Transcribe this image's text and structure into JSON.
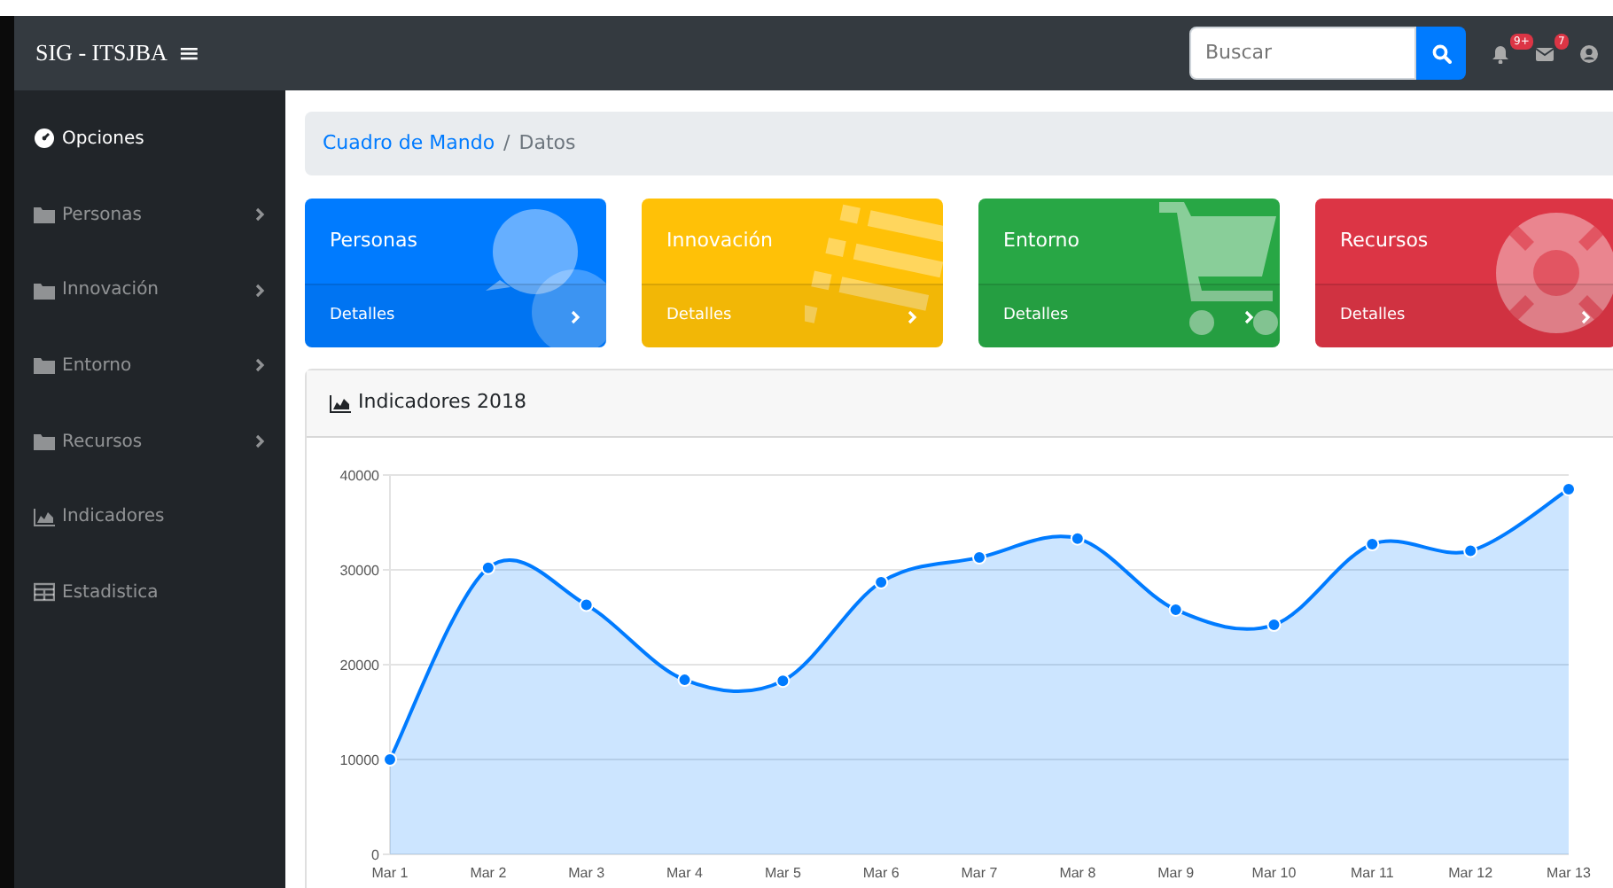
{
  "navbar": {
    "brand": "SIG - ITSJBA",
    "menu_toggle": "≡",
    "search": {
      "placeholder": "Buscar"
    },
    "alerts": {
      "badge": "9+"
    },
    "messages": {
      "badge": "7"
    }
  },
  "sidebar": {
    "items": [
      {
        "label": "Opciones",
        "expandable": false,
        "selected": true
      },
      {
        "label": "Personas",
        "expandable": true,
        "selected": false
      },
      {
        "label": "Innovación",
        "expandable": true,
        "selected": false
      },
      {
        "label": "Entorno",
        "expandable": true,
        "selected": false
      },
      {
        "label": "Recursos",
        "expandable": true,
        "selected": false
      },
      {
        "label": "Indicadores",
        "expandable": false,
        "selected": false
      },
      {
        "label": "Estadistica",
        "expandable": false,
        "selected": false
      }
    ]
  },
  "breadcrumb": {
    "separator": "/",
    "items": [
      {
        "label": "Cuadro de Mando",
        "kind": "link"
      },
      {
        "label": "Datos",
        "kind": "current"
      }
    ]
  },
  "cards": [
    {
      "title": "Personas",
      "link": "Detalles",
      "color": "#007bff"
    },
    {
      "title": "Innovación",
      "link": "Detalles",
      "color": "#ffc107"
    },
    {
      "title": "Entorno",
      "link": "Detalles",
      "color": "#28a745"
    },
    {
      "title": "Recursos",
      "link": "Detalles",
      "color": "#dc3545"
    }
  ],
  "chart_card": {
    "title": "Indicadores 2018",
    "chart_data": {
      "type": "area",
      "categories": [
        "Mar 1",
        "Mar 2",
        "Mar 3",
        "Mar 4",
        "Mar 5",
        "Mar 6",
        "Mar 7",
        "Mar 8",
        "Mar 9",
        "Mar 10",
        "Mar 11",
        "Mar 12",
        "Mar 13"
      ],
      "series": [
        {
          "color": "#007bff",
          "values": [
            10000,
            30200,
            26300,
            18400,
            18300,
            28700,
            31300,
            33300,
            25800,
            24200,
            32700,
            32000,
            38500
          ]
        }
      ],
      "ylim": [
        0,
        40000
      ],
      "yticks": [
        0,
        10000,
        20000,
        30000,
        40000
      ],
      "grid": true
    }
  }
}
